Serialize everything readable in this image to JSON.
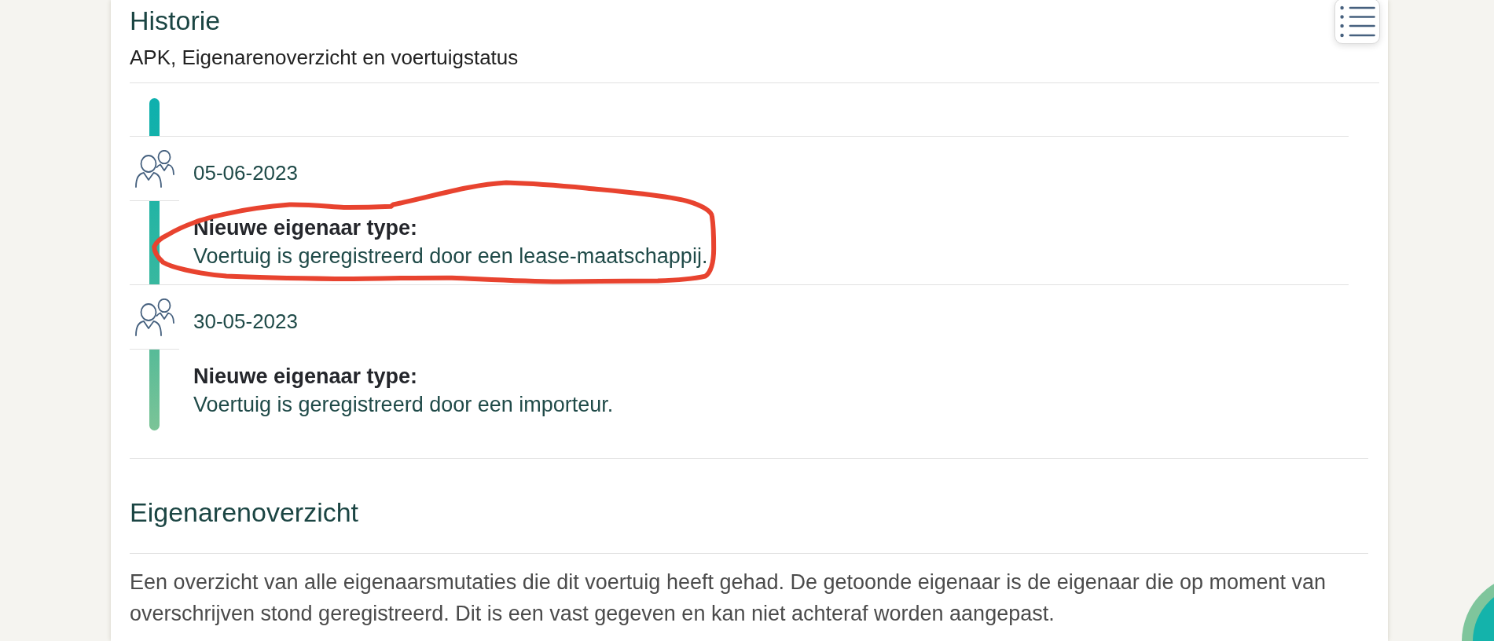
{
  "history": {
    "title": "Historie",
    "subtitle": "APK, Eigenarenoverzicht en voertuigstatus",
    "entries": [
      {
        "date": "05-06-2023",
        "label": "Nieuwe eigenaar type:",
        "value": "Voertuig is geregistreerd door een lease-maatschappij.",
        "highlighted": true
      },
      {
        "date": "30-05-2023",
        "label": "Nieuwe eigenaar type:",
        "value": "Voertuig is geregistreerd door een importeur.",
        "highlighted": false
      }
    ]
  },
  "owners_overview": {
    "title": "Eigenarenoverzicht",
    "description": "Een overzicht van alle eigenaarsmutaties die dit voertuig heeft gehad. De getoonde eigenaar is de eigenaar die op moment van overschrijven stond geregistreerd. Dit is een vast gegeven en kan niet achteraf worden aangepast."
  }
}
